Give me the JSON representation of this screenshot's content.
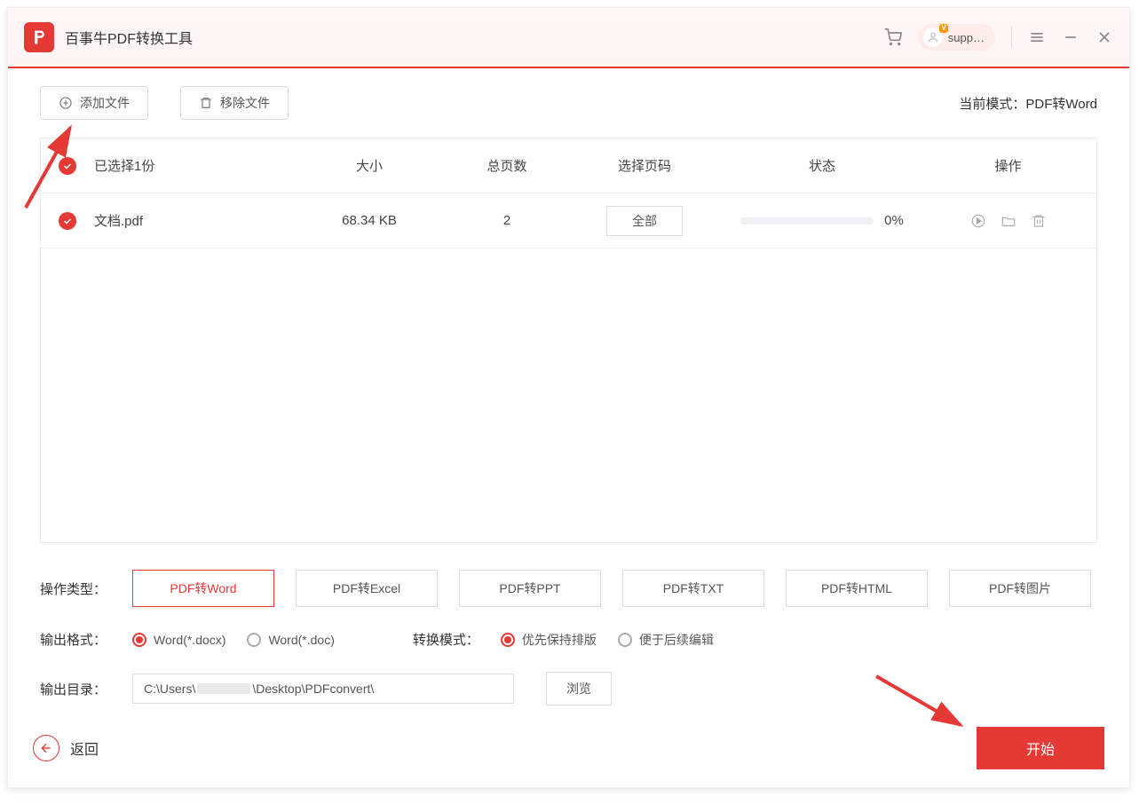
{
  "header": {
    "title": "百事牛PDF转换工具",
    "user": "supp…"
  },
  "toolbar": {
    "add_file": "添加文件",
    "remove_file": "移除文件",
    "mode_label": "当前模式：",
    "mode_value": "PDF转Word"
  },
  "table": {
    "headers": {
      "selected": "已选择1份",
      "size": "大小",
      "pages": "总页数",
      "page_select": "选择页码",
      "status": "状态",
      "actions": "操作"
    },
    "rows": [
      {
        "name": "文档.pdf",
        "size": "68.34 KB",
        "pages": "2",
        "page_btn": "全部",
        "percent": "0%"
      }
    ]
  },
  "options": {
    "type_label": "操作类型：",
    "types": [
      "PDF转Word",
      "PDF转Excel",
      "PDF转PPT",
      "PDF转TXT",
      "PDF转HTML",
      "PDF转图片"
    ],
    "format_label": "输出格式：",
    "formats": [
      "Word(*.docx)",
      "Word(*.doc)"
    ],
    "convert_label": "转换模式：",
    "convert_modes": [
      "优先保持排版",
      "便于后续编辑"
    ],
    "dir_label": "输出目录：",
    "dir_prefix": "C:\\Users\\",
    "dir_suffix": "\\Desktop\\PDFconvert\\",
    "browse": "浏览"
  },
  "footer": {
    "back": "返回",
    "start": "开始"
  }
}
